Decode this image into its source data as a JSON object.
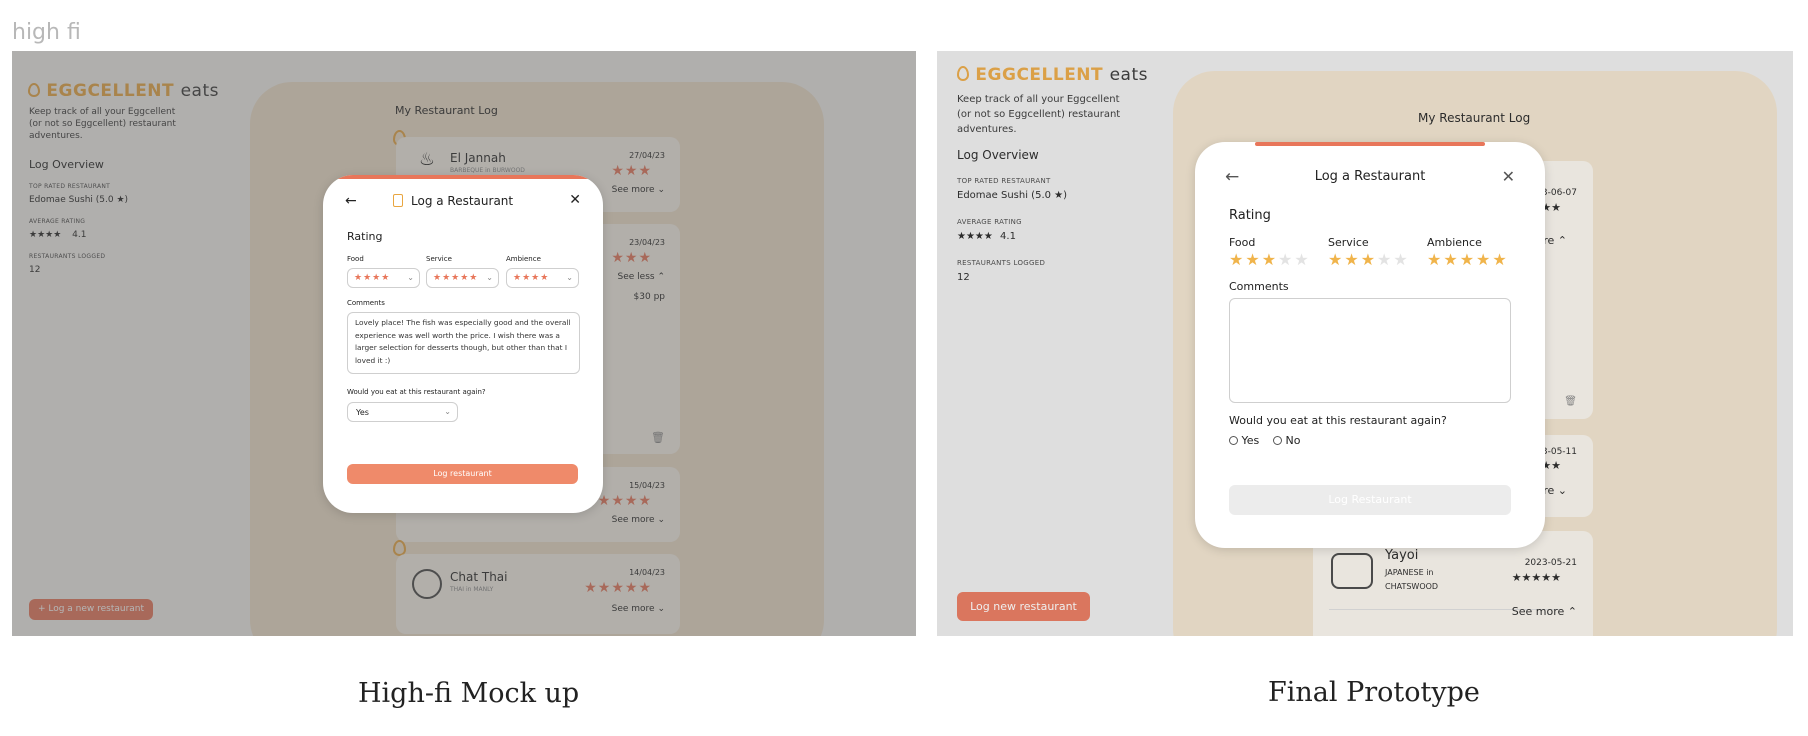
{
  "page_label": "high fi",
  "captions": {
    "left": "High-fi Mock up",
    "right": "Final Prototype"
  },
  "colors": {
    "brand": "#e9a640",
    "coral": "#e8765a",
    "log_bg": "#f0e2cc",
    "rating_gold": "#f0b44b"
  },
  "hifi": {
    "logo": {
      "brand": "EGGCELLENT",
      "suffix": "eats",
      "icon": "egg-icon"
    },
    "tagline": "Keep track of all your Eggcellent (or not so Eggcellent) restaurant adventures.",
    "overview": {
      "title": "Log Overview",
      "top_rated_label": "TOP RATED RESTAURANT",
      "top_rated_value": "Edomae Sushi (5.0 ★)",
      "avg_label": "AVERAGE RATING",
      "avg_stars": "★★★★",
      "avg_value": "4.1",
      "count_label": "RESTAURANTS LOGGED",
      "count_value": "12"
    },
    "log_title": "My Restaurant Log",
    "new_button": "+ Log a new restaurant",
    "cards": [
      {
        "name": "El Jannah",
        "meta": "BARBEQUE in BURWOOD",
        "date": "27/04/23",
        "stars": "★★★",
        "toggle": "See more ⌄",
        "icon": "bbq-icon"
      },
      {
        "name": "",
        "meta": "",
        "date": "23/04/23",
        "stars": "★★★",
        "toggle": "See less ⌃",
        "price": "$30 pp",
        "icon": "trash-icon"
      },
      {
        "name": "",
        "meta": "... in ...",
        "date": "15/04/23",
        "stars": "★★★★",
        "toggle": "See more ⌄",
        "icon": ""
      },
      {
        "name": "Chat Thai",
        "meta": "THAI in MANLY",
        "date": "14/04/23",
        "stars": "★★★★★",
        "toggle": "See more ⌄",
        "icon": "thai-bowl-icon"
      }
    ],
    "modal": {
      "title": "Log a Restaurant",
      "rating_label": "Rating",
      "food_label": "Food",
      "food_stars": "★★★★",
      "service_label": "Service",
      "service_stars": "★★★★★",
      "ambience_label": "Ambience",
      "ambience_stars": "★★★★",
      "comments_label": "Comments",
      "comments_value": "Lovely place! The fish was especially good and the overall experience was well worth the price. I wish there was a larger selection for desserts though, but other than that I loved it :)",
      "again_label": "Would you eat at this restaurant again?",
      "again_value": "Yes",
      "submit": "Log restaurant"
    }
  },
  "final": {
    "logo": {
      "brand": "EGGCELLENT",
      "suffix": "eats",
      "icon": "egg-icon"
    },
    "tagline": "Keep track of all your Eggcellent (or not so Eggcellent) restaurant adventures.",
    "overview": {
      "title": "Log Overview",
      "top_rated_label": "TOP RATED RESTAURANT",
      "top_rated_value": "Edomae Sushi (5.0 ★)",
      "avg_label": "AVERAGE RATING",
      "avg_stars": "★★★★",
      "avg_value": "4.1",
      "count_label": "RESTAURANTS LOGGED",
      "count_value": "12"
    },
    "log_title": "My Restaurant Log",
    "new_button": "Log new restaurant",
    "cards": [
      {
        "date": "2023-06-07",
        "stars": "★★★",
        "toggle": "ee more ⌃"
      },
      {
        "date": "2023-05-11",
        "stars": "★★★",
        "toggle": "ee more ⌄"
      },
      {
        "name": "Yayoi",
        "meta1": "JAPANESE in",
        "meta2": "CHATSWOOD",
        "date": "2023-05-21",
        "stars": "★★★★★",
        "toggle": "See more ⌃"
      }
    ],
    "modal": {
      "title": "Log a Restaurant",
      "rating_label": "Rating",
      "food_label": "Food",
      "food_rating": 3,
      "service_label": "Service",
      "service_rating": 3,
      "ambience_label": "Ambience",
      "ambience_rating": 5,
      "star_char": "★",
      "comments_label": "Comments",
      "comments_value": "",
      "again_label": "Would you eat at this restaurant again?",
      "yes": "Yes",
      "no": "No",
      "submit": "Log Restaurant"
    }
  }
}
